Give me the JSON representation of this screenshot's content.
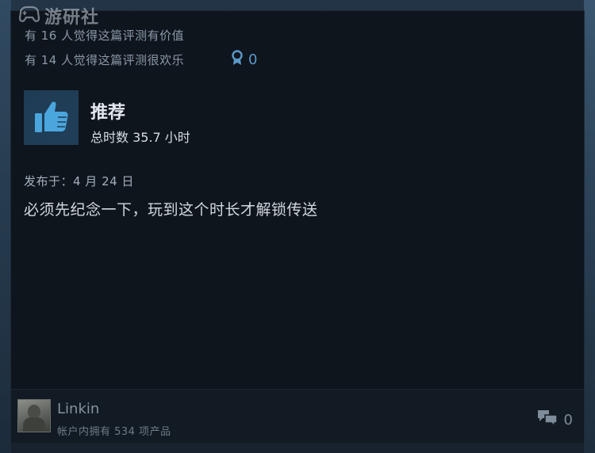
{
  "watermark": {
    "text": "游研社",
    "icon": "gamepad-logo-icon"
  },
  "review": {
    "helpful_line": "有 16 人觉得这篇评测有价值",
    "funny_line": "有 14 人觉得这篇评测很欢乐",
    "award_count": "0",
    "award_icon": "award-ribbon-icon",
    "verdict": "推荐",
    "verdict_icon": "thumbs-up-icon",
    "hours": "总时数 35.7 小时",
    "posted": "发布于：4 月 24 日",
    "text": "必须先纪念一下，玩到这个时长才解锁传送"
  },
  "author": {
    "name": "Linkin",
    "products": "帐户内拥有 534 项产品"
  },
  "comments": {
    "count": "0",
    "icon": "comment-bubbles-icon"
  },
  "colors": {
    "card_background": "#0f151d",
    "accent_blue": "#5a98c8",
    "thumb_blue": "#4aa6dd"
  }
}
